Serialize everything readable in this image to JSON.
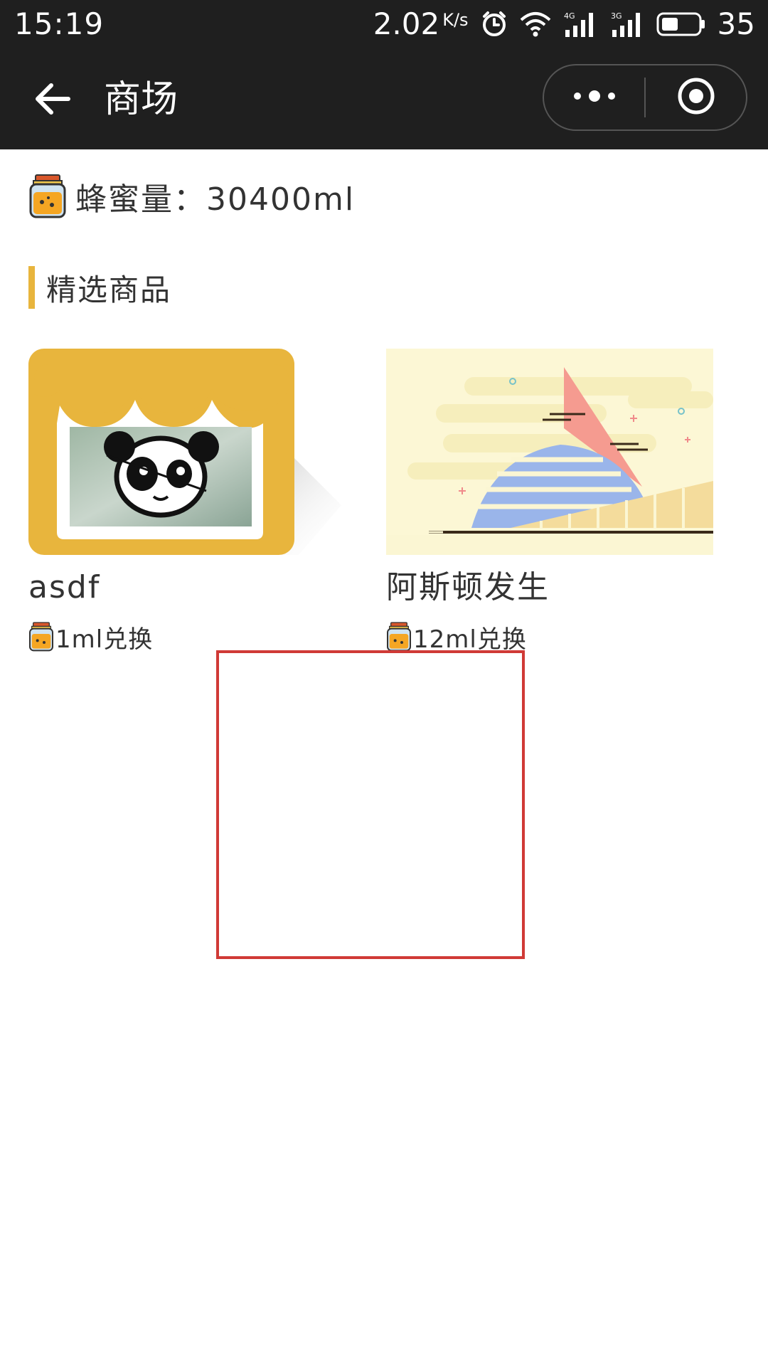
{
  "status_bar": {
    "time": "15:19",
    "speed": "2.02",
    "speed_unit": "K/s",
    "battery_percent": "35",
    "signal_1_label": "4G",
    "signal_2_label": "3G"
  },
  "nav": {
    "title": "商场"
  },
  "honey": {
    "label": "蜂蜜量：30400ml"
  },
  "section": {
    "title": "精选商品"
  },
  "products": [
    {
      "name": "asdf",
      "price": "1ml兑换",
      "image": "panda-shop-image"
    },
    {
      "name": "阿斯顿发生",
      "price": "12ml兑换",
      "image": "building-illustration-image"
    }
  ],
  "colors": {
    "header_bg": "#1f1f1f",
    "accent": "#e8b53d",
    "text": "#333333",
    "highlight_border": "#d03a36"
  }
}
